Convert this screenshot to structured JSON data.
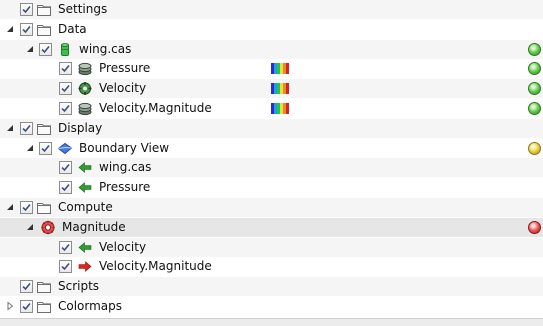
{
  "tree": {
    "rows": [
      {
        "label": "Settings",
        "level": 0,
        "expander": "none",
        "icon": "folder",
        "checked": true,
        "bg": "alt"
      },
      {
        "label": "Data",
        "level": 0,
        "expander": "expanded",
        "icon": "folder",
        "checked": true,
        "bg": "base"
      },
      {
        "label": "wing.cas",
        "level": 1,
        "expander": "expanded",
        "icon": "dataset-cylinder",
        "checked": true,
        "bg": "alt",
        "status": "green"
      },
      {
        "label": "Pressure",
        "level": 2,
        "expander": "none",
        "icon": "scalar-field",
        "checked": true,
        "bg": "base",
        "colormap": true,
        "status": "green"
      },
      {
        "label": "Velocity",
        "level": 2,
        "expander": "none",
        "icon": "vector-field",
        "checked": true,
        "bg": "alt",
        "colormap": true,
        "status": "green"
      },
      {
        "label": "Velocity.Magnitude",
        "level": 2,
        "expander": "none",
        "icon": "scalar-field",
        "checked": true,
        "bg": "base",
        "colormap": true,
        "status": "green"
      },
      {
        "label": "Display",
        "level": 0,
        "expander": "expanded",
        "icon": "folder",
        "checked": true,
        "bg": "alt"
      },
      {
        "label": "Boundary View",
        "level": 1,
        "expander": "expanded",
        "icon": "boundary-view",
        "checked": true,
        "bg": "base",
        "status": "yellow"
      },
      {
        "label": "wing.cas",
        "level": 2,
        "expander": "none",
        "icon": "input-arrow-green",
        "checked": true,
        "bg": "alt"
      },
      {
        "label": "Pressure",
        "level": 2,
        "expander": "none",
        "icon": "input-arrow-green",
        "checked": true,
        "bg": "base"
      },
      {
        "label": "Compute",
        "level": 0,
        "expander": "expanded",
        "icon": "folder",
        "checked": true,
        "bg": "alt"
      },
      {
        "label": "Magnitude",
        "level": 1,
        "expander": "expanded",
        "icon": "compute-gear",
        "checked": null,
        "bg": "base",
        "status": "red",
        "selected": true
      },
      {
        "label": "Velocity",
        "level": 2,
        "expander": "none",
        "icon": "input-arrow-green",
        "checked": true,
        "bg": "alt"
      },
      {
        "label": "Velocity.Magnitude",
        "level": 2,
        "expander": "none",
        "icon": "output-arrow-red",
        "checked": true,
        "bg": "base"
      },
      {
        "label": "Scripts",
        "level": 0,
        "expander": "none",
        "icon": "folder",
        "checked": true,
        "bg": "alt"
      },
      {
        "label": "Colormaps",
        "level": 0,
        "expander": "collapsed",
        "icon": "folder",
        "checked": true,
        "bg": "base"
      }
    ]
  },
  "colors": {
    "status_green": "#4caf3a",
    "status_yellow": "#d4c23a",
    "status_red": "#d63c3c",
    "arrow_green": "#2f9e2f",
    "arrow_red": "#e0231b",
    "colormap": [
      "#2e2bd6",
      "#1aa0e6",
      "#27c24a",
      "#e6e13a",
      "#e98a2a",
      "#d62424"
    ]
  }
}
